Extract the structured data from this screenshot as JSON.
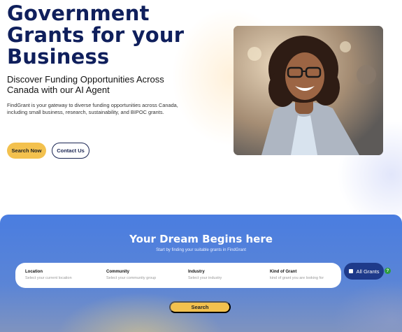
{
  "hero": {
    "title": "Government Grants for your Business",
    "subtitle": "Discover Funding Opportunities Across Canada with our AI Agent",
    "description": "FindGrant is your gateway to diverse funding opportunities across Canada, including small business, research, sustainability, and BIPOC grants.",
    "search_now_label": "Search Now",
    "contact_label": "Contact Us"
  },
  "search_section": {
    "title": "Your Dream Begins here",
    "subtitle": "Start by finding your suitable grants in FindGrant",
    "fields": [
      {
        "label": "Location",
        "placeholder": "Select your current location"
      },
      {
        "label": "Community",
        "placeholder": "Select your community group"
      },
      {
        "label": "Industry",
        "placeholder": "Select your industry"
      },
      {
        "label": "Kind of Grant",
        "placeholder": "kind of grant you are looking for"
      }
    ],
    "all_grants_label": "All Grants",
    "help_label": "?",
    "search_label": "Search"
  },
  "colors": {
    "title_navy": "#0f1f5c",
    "accent_yellow": "#f3c14e",
    "band_blue": "#4a7de0",
    "pill_navy": "#1e3a8a"
  },
  "icons": {
    "checkbox": "checkbox-icon",
    "help": "help-icon"
  }
}
